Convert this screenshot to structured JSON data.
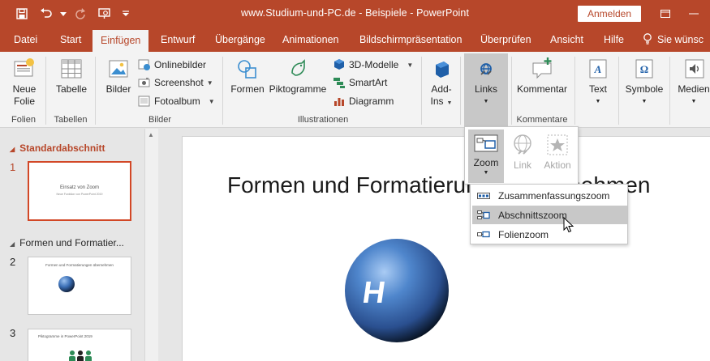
{
  "window": {
    "title": "www.Studium-und-PC.de - Beispiele - PowerPoint",
    "signin_label": "Anmelden"
  },
  "tabs": [
    {
      "label": "Datei"
    },
    {
      "label": "Start"
    },
    {
      "label": "Einfügen"
    },
    {
      "label": "Entwurf"
    },
    {
      "label": "Übergänge"
    },
    {
      "label": "Animationen"
    },
    {
      "label": "Bildschirmpräsentation"
    },
    {
      "label": "Überprüfen"
    },
    {
      "label": "Ansicht"
    },
    {
      "label": "Hilfe"
    },
    {
      "label": "Sie wünsc"
    }
  ],
  "ribbon": {
    "neue_folie": [
      "Neue",
      "Folie"
    ],
    "tabelle": "Tabelle",
    "bilder": "Bilder",
    "onlinebilder": "Onlinebilder",
    "screenshot": "Screenshot",
    "fotoalbum": "Fotoalbum",
    "formen": "Formen",
    "piktogramme": "Piktogramme",
    "modelle3d": "3D-Modelle",
    "smartart": "SmartArt",
    "diagramm": "Diagramm",
    "addins": [
      "Add-",
      "Ins"
    ],
    "links": "Links",
    "kommentar": "Kommentar",
    "text": "Text",
    "symbole": "Symbole",
    "medien": "Medien",
    "groups": {
      "folien": "Folien",
      "tabellen": "Tabellen",
      "bilder": "Bilder",
      "illustrationen": "Illustrationen",
      "kommentare": "Kommentare"
    }
  },
  "links_dropdown": {
    "zoom": "Zoom",
    "link": "Link",
    "aktion": "Aktion"
  },
  "zoom_menu": {
    "items": [
      {
        "label": "Zusammenfassungszoom"
      },
      {
        "label": "Abschnittszoom"
      },
      {
        "label": "Folienzoom"
      }
    ]
  },
  "panel": {
    "section1": "Standardabschnitt",
    "section2": "Formen und Formatier...",
    "slides": [
      {
        "number": "1",
        "title": "Einsatz von Zoom",
        "subtitle": "Neue Funktion von PowerPoint 2019"
      },
      {
        "number": "2",
        "title": "Formen und Formatierungen übernehmen"
      },
      {
        "number": "3",
        "title": "Piktogramme in PowerPoint 2019"
      }
    ]
  },
  "slide": {
    "title": "Formen und Formatierungen übernehmen",
    "sphere_letter": "H"
  },
  "colors": {
    "accent": "#b7472a",
    "ribbon_bg": "#f3f3f3",
    "highlight": "#c8c8c8",
    "sphere": "#3b6fb6"
  }
}
